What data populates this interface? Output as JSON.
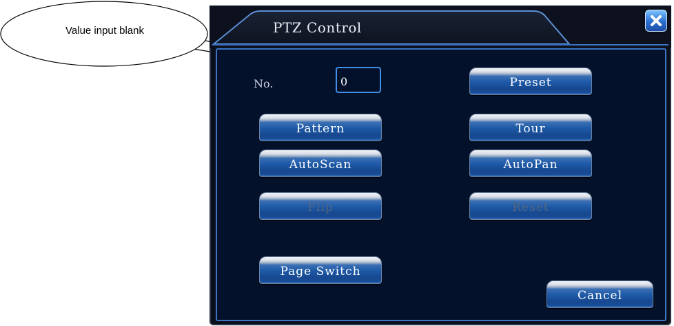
{
  "annotation": {
    "callout_text": "Value input blank"
  },
  "dialog": {
    "title": "PTZ Control",
    "close_icon": "close-x-icon",
    "no_label": "No.",
    "no_value": "0",
    "buttons": {
      "preset": "Preset",
      "pattern": "Pattern",
      "tour": "Tour",
      "autoscan": "AutoScan",
      "autopan": "AutoPan",
      "flip": "Flip",
      "reset": "Reset",
      "page_switch": "Page Switch",
      "cancel": "Cancel"
    }
  },
  "colors": {
    "dialog_bg": "#0a0f1c",
    "panel_border": "#3a74c4",
    "button_blue": "#1e5aa8",
    "disabled_text": "#52657f"
  }
}
